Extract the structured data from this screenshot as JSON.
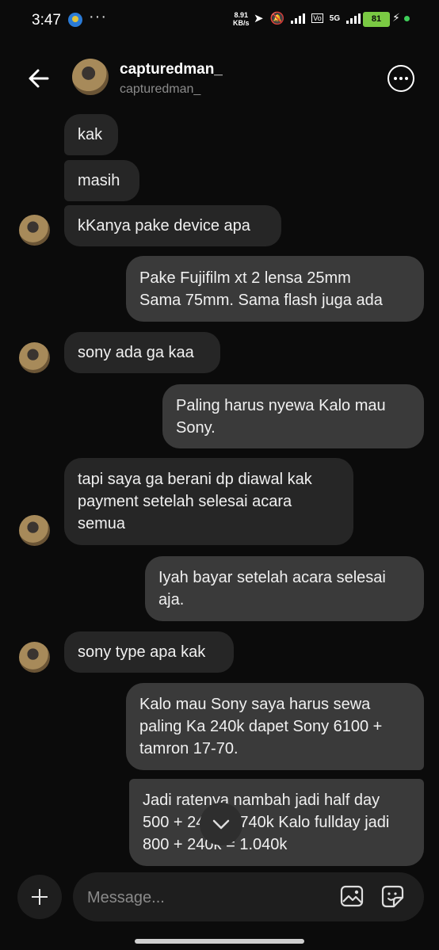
{
  "status": {
    "time": "3:47",
    "more": "···",
    "speed_value": "8.91",
    "speed_unit": "KB/s",
    "battery": "81",
    "network": "5G"
  },
  "header": {
    "username": "capturedman_",
    "handle": "capturedman_"
  },
  "messages": [
    {
      "dir": "in",
      "text": "kak"
    },
    {
      "dir": "in",
      "text": "masih"
    },
    {
      "dir": "in",
      "text": "kKanya pake device apa"
    },
    {
      "dir": "out",
      "text": "Pake Fujifilm xt 2 lensa 25mm\nSama 75mm. Sama flash juga ada"
    },
    {
      "dir": "in",
      "text": "sony ada ga kaa"
    },
    {
      "dir": "out",
      "text": "Paling harus nyewa Kalo mau\nSony."
    },
    {
      "dir": "in",
      "text": "tapi saya ga berani dp diawal kak\npayment setelah selesai acara\nsemua"
    },
    {
      "dir": "out",
      "text": "Iyah bayar setelah acara selesai\naja."
    },
    {
      "dir": "in",
      "text": "sony type apa kak"
    },
    {
      "dir": "out",
      "text": "Kalo mau Sony saya harus sewa\npaling Ka 240k dapet Sony 6100 +\ntamron 17-70."
    },
    {
      "dir": "out",
      "text": "Jadi ratenya nambah jadi half day\n500 + 240k = 740k Kalo fullday jadi\n800 + 240k = 1.040k"
    }
  ],
  "composer": {
    "placeholder": "Message..."
  },
  "icons": {
    "back": "arrow-left-icon",
    "more": "more-options-icon",
    "add": "plus-icon",
    "gallery": "gallery-icon",
    "sticker": "sticker-icon",
    "scroll": "chevron-down-icon"
  },
  "colors": {
    "background": "#0b0b0b",
    "incoming_bubble": "#262626",
    "outgoing_bubble": "#3a3a3a",
    "battery": "#7ac943"
  }
}
